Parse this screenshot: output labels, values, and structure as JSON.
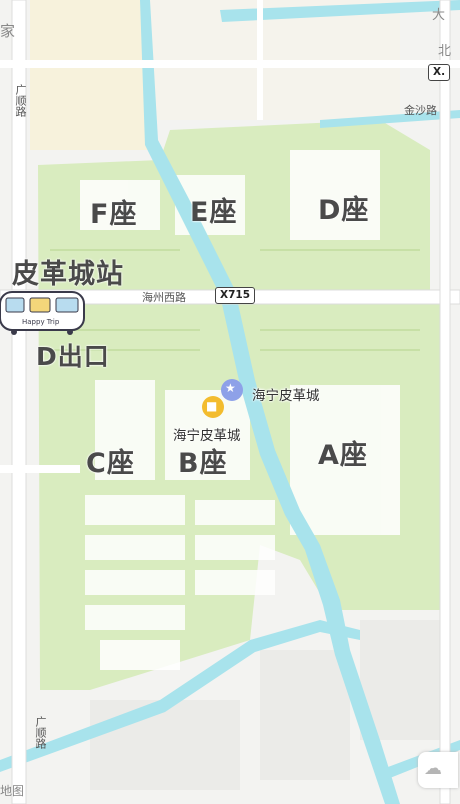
{
  "buildings": {
    "f": "F座",
    "e": "E座",
    "d": "D座",
    "a": "A座",
    "b": "B座",
    "c": "C座"
  },
  "station_label": "皮革城站",
  "exit_label": "D出口",
  "train_caption": "Happy Trip",
  "roads": {
    "west_top": "广顺路",
    "west_bottom": "广顺路",
    "haizhou": "海州西路",
    "jinsha": "金沙路"
  },
  "route_shield": "X715",
  "top_right_shield": "X.",
  "pois": {
    "landmark": "海宁皮革城",
    "mall": "海宁皮革城"
  },
  "edge_text": {
    "top_left": "家",
    "top_right_1": "大",
    "top_right_2": "北",
    "bottom_left": "地图"
  },
  "colors": {
    "green": "#d9ecbf",
    "river": "#a8e3ec",
    "block": "#ffffff",
    "label": "#4a4a4a"
  }
}
